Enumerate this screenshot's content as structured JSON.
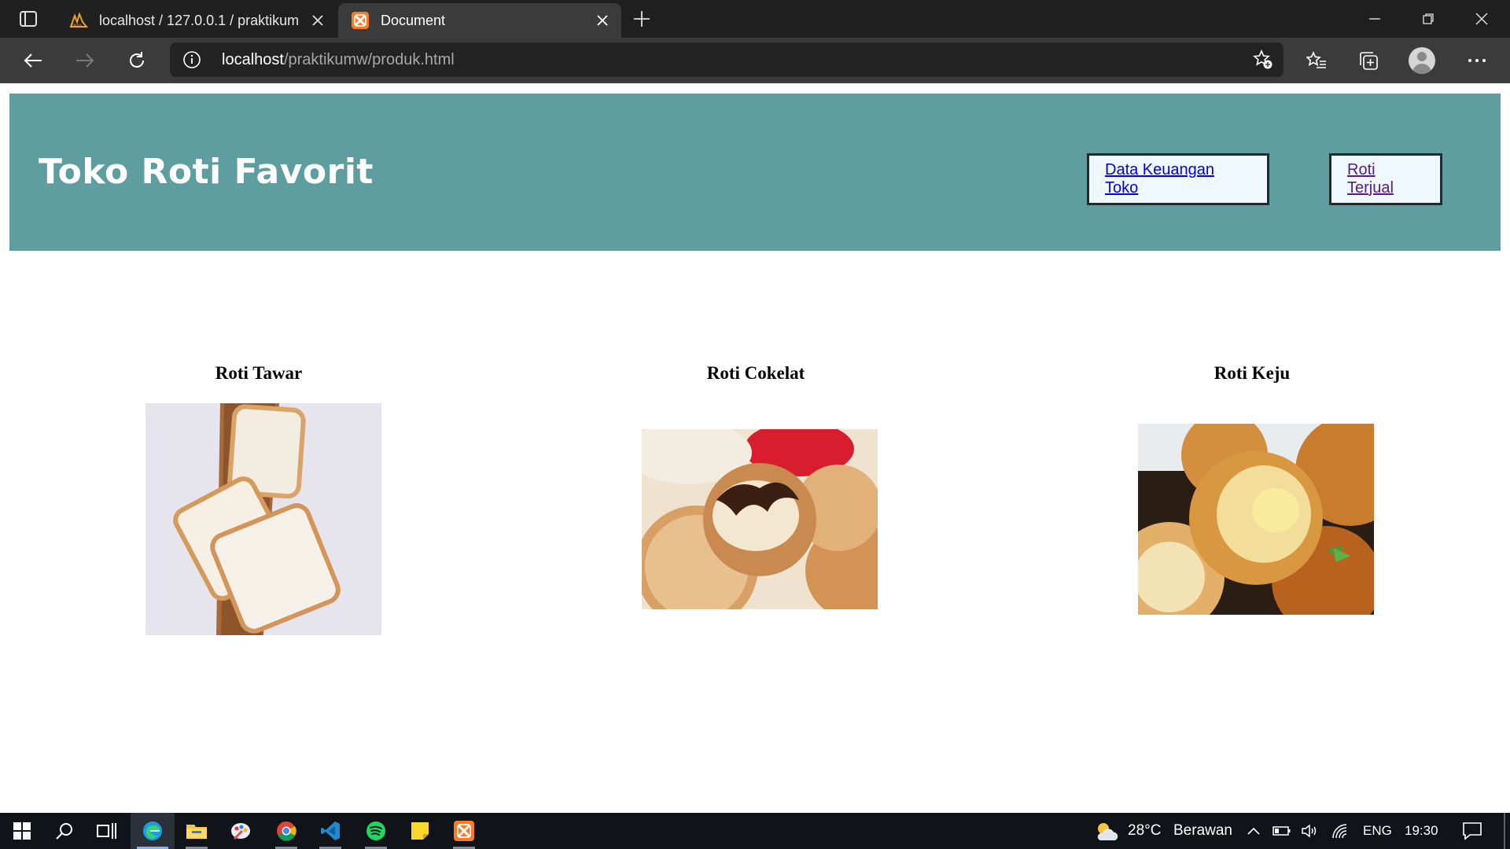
{
  "browser": {
    "tabs": [
      {
        "title": "localhost / 127.0.0.1 / praktikum",
        "favicon": "phpmyadmin-icon",
        "active": false
      },
      {
        "title": "Document",
        "favicon": "xampp-icon",
        "active": true
      }
    ],
    "address": {
      "host": "localhost",
      "path": "/praktikumw/produk.html"
    }
  },
  "page": {
    "title": "Toko Roti Favorit",
    "nav": [
      {
        "label": "Data Keuangan Toko"
      },
      {
        "label": "Roti Terjual"
      }
    ],
    "products": [
      {
        "name": "Roti Tawar"
      },
      {
        "name": "Roti Cokelat"
      },
      {
        "name": "Roti Keju"
      }
    ],
    "colors": {
      "header_bg": "#5f9ea0",
      "nav_box_bg": "#f0f8ff",
      "link": "#0000ee",
      "visited_link": "#551a8b"
    }
  },
  "taskbar": {
    "apps": [
      "windows-start-icon",
      "search-icon",
      "task-view-icon",
      "edge-icon",
      "file-explorer-icon",
      "paint-icon",
      "chrome-icon",
      "vscode-icon",
      "spotify-icon",
      "sticky-notes-icon",
      "xampp-icon"
    ],
    "weather": {
      "temp": "28°C",
      "condition": "Berawan"
    },
    "language": "ENG",
    "time": "19:30"
  }
}
